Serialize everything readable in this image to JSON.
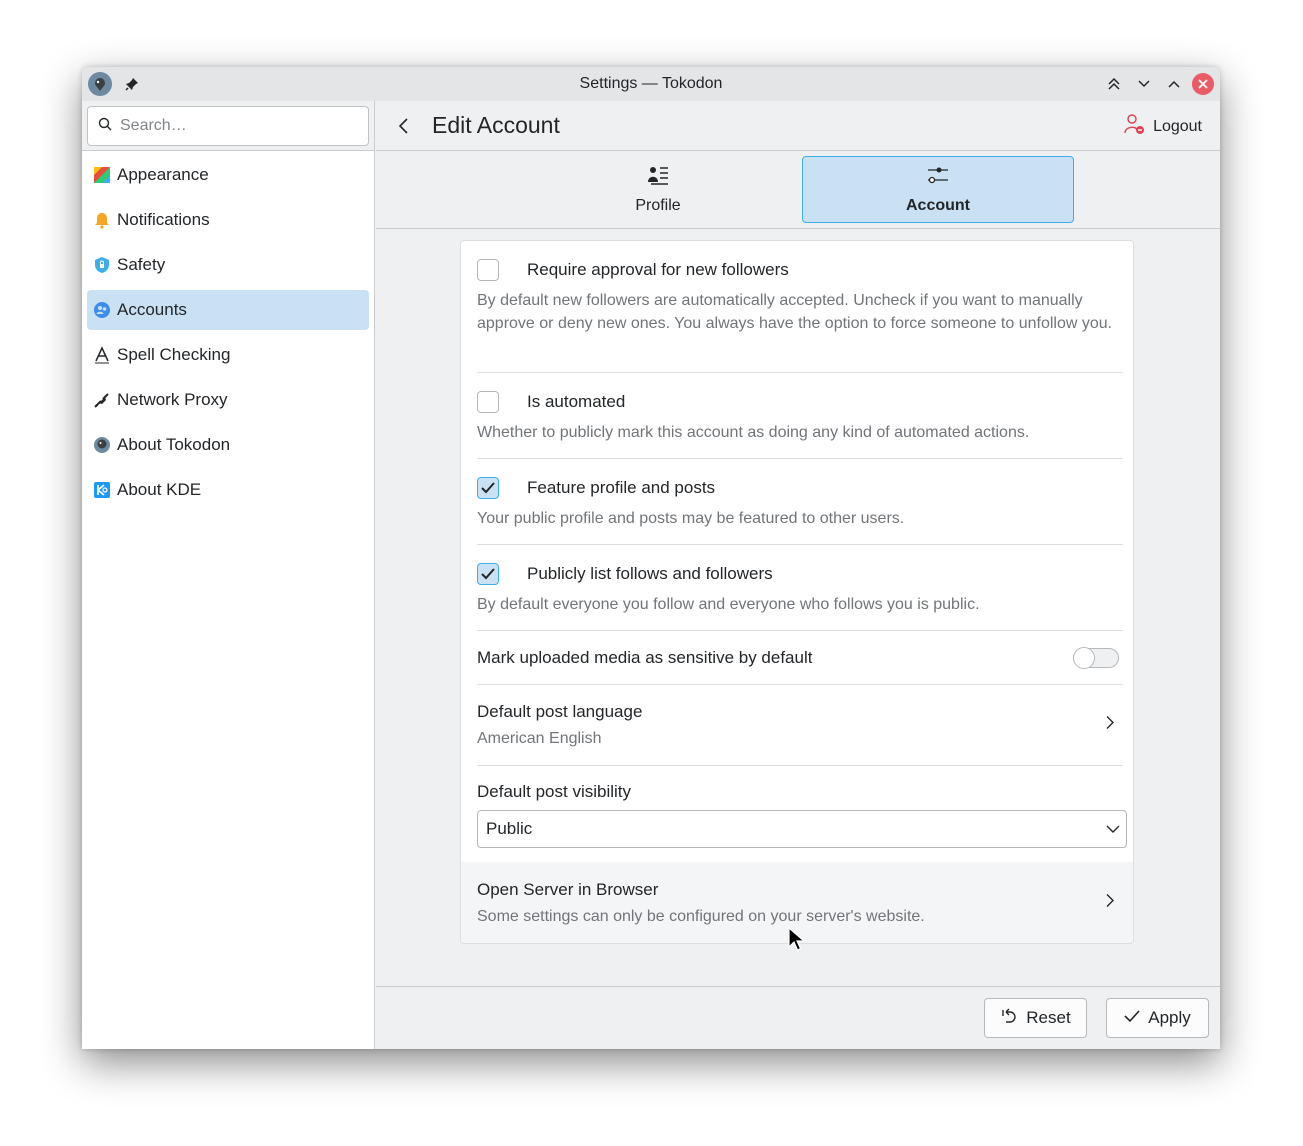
{
  "window": {
    "title": "Settings — Tokodon"
  },
  "sidebar": {
    "search_placeholder": "Search…",
    "items": [
      {
        "label": "Appearance",
        "icon": "appearance-icon"
      },
      {
        "label": "Notifications",
        "icon": "bell-icon"
      },
      {
        "label": "Safety",
        "icon": "shield-icon"
      },
      {
        "label": "Accounts",
        "icon": "accounts-icon",
        "active": true
      },
      {
        "label": "Spell Checking",
        "icon": "spellcheck-icon"
      },
      {
        "label": "Network Proxy",
        "icon": "network-proxy-icon"
      },
      {
        "label": "About Tokodon",
        "icon": "tokodon-icon"
      },
      {
        "label": "About KDE",
        "icon": "kde-icon"
      }
    ]
  },
  "header": {
    "title": "Edit Account",
    "logout_label": "Logout"
  },
  "tabs": [
    {
      "label": "Profile",
      "icon": "profile-icon",
      "active": false
    },
    {
      "label": "Account",
      "icon": "sliders-icon",
      "active": true
    }
  ],
  "settings": {
    "require_approval": {
      "label": "Require approval for new followers",
      "description": "By default new followers are automatically accepted. Uncheck if you want to manually approve or deny new ones. You always have the option to force someone to unfollow you.",
      "checked": false
    },
    "is_automated": {
      "label": "Is automated",
      "description": "Whether to publicly mark this account as doing any kind of automated actions.",
      "checked": false
    },
    "feature_profile": {
      "label": "Feature profile and posts",
      "description": "Your public profile and posts may be featured to other users.",
      "checked": true
    },
    "publicly_list": {
      "label": "Publicly list follows and followers",
      "description": "By default everyone you follow and everyone who follows you is public.",
      "checked": true
    },
    "sensitive_media": {
      "label": "Mark uploaded media as sensitive by default",
      "enabled": false
    },
    "post_language": {
      "label": "Default post language",
      "value": "American English"
    },
    "post_visibility": {
      "label": "Default post visibility",
      "value": "Public"
    },
    "open_server": {
      "label": "Open Server in Browser",
      "description": "Some settings can only be configured on your server's website."
    }
  },
  "footer": {
    "reset_label": "Reset",
    "apply_label": "Apply"
  },
  "colors": {
    "accent": "#3daee9",
    "selection": "#c9e1f3",
    "close": "#e95b67"
  }
}
